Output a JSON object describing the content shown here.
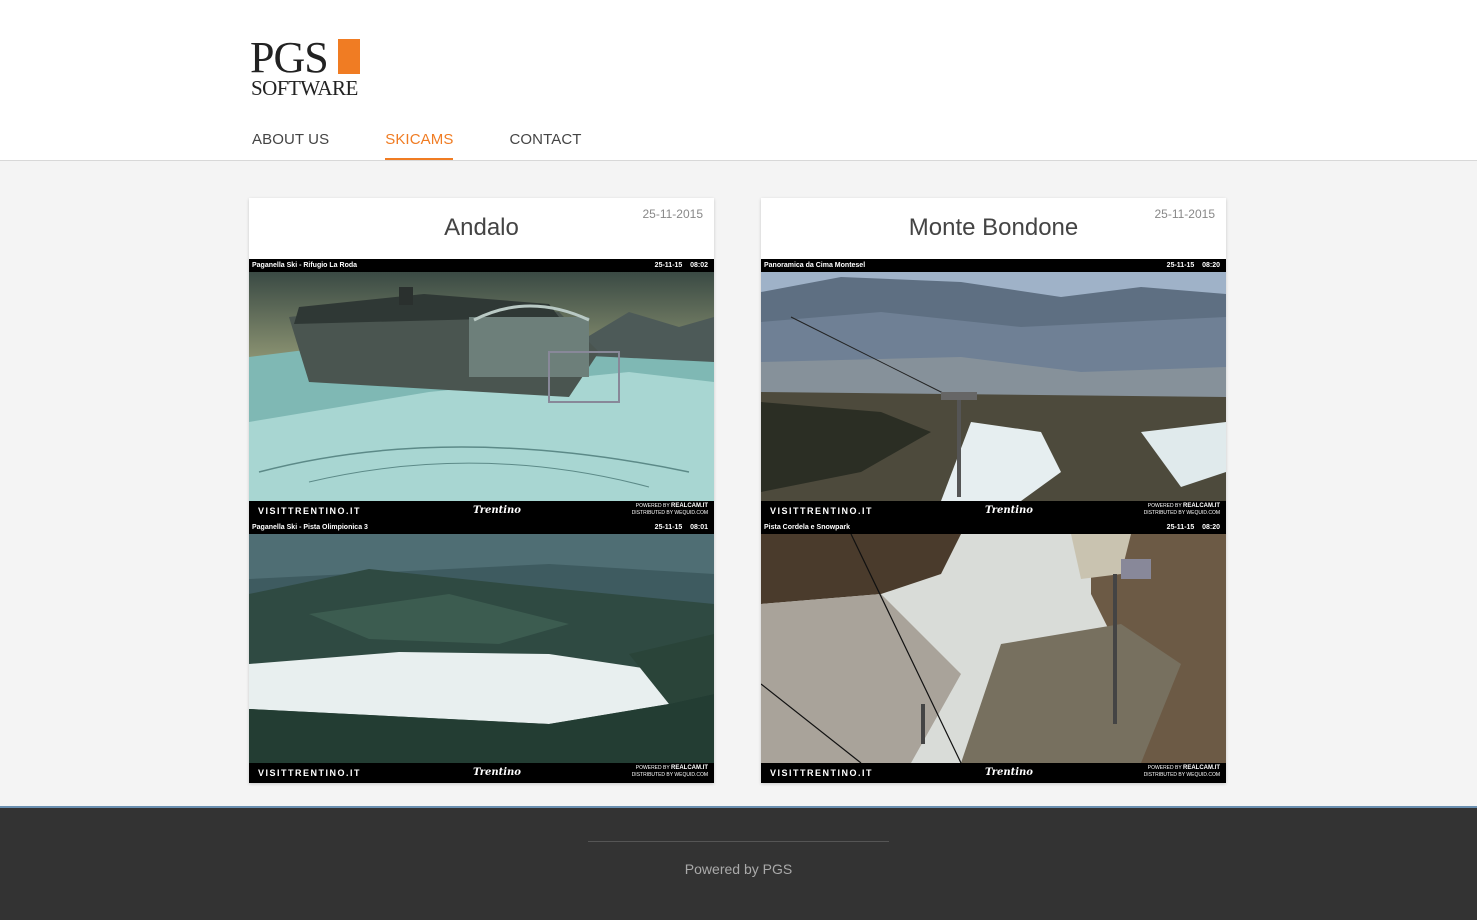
{
  "logo": {
    "text_top": "PGS",
    "text_bottom": "SOFTWARE",
    "accent": "#f07c23"
  },
  "nav": {
    "items": [
      {
        "label": "ABOUT US"
      },
      {
        "label": "SKICAMS"
      },
      {
        "label": "CONTACT"
      }
    ],
    "active": "SKICAMS"
  },
  "cards": [
    {
      "title": "Andalo",
      "date": "25-11-2015",
      "cams": [
        {
          "caption": "Paganella Ski - Rifugio La Roda",
          "date": "25-11-15",
          "time": "08:02"
        },
        {
          "caption": "Paganella Ski - Pista Olimpionica 3",
          "date": "25-11-15",
          "time": "08:01"
        }
      ]
    },
    {
      "title": "Monte Bondone",
      "date": "25-11-2015",
      "cams": [
        {
          "caption": "Panoramica da Cima Montesel",
          "date": "25-11-15",
          "time": "08:20"
        },
        {
          "caption": "Pista Cordela e Snowpark",
          "date": "25-11-15",
          "time": "08:20"
        }
      ]
    }
  ],
  "cam_branding": {
    "visit": "VISITTRENTINO.IT",
    "trentino": "Trentino",
    "powered_by": "POWERED BY",
    "realcam": "REALCAM.IT",
    "distributed_by": "DISTRIBUTED BY",
    "wequid": "WEQUID.COM"
  },
  "footer": {
    "text": "Powered by PGS"
  }
}
